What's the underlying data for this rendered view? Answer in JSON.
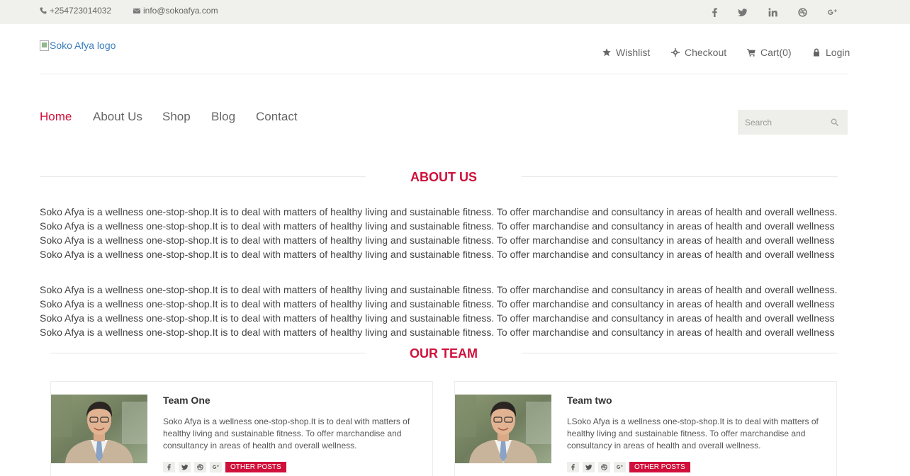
{
  "topbar": {
    "phone": "+254723014032",
    "email": "info@sokoafya.com",
    "social_icons": [
      "facebook-icon",
      "twitter-icon",
      "linkedin-icon",
      "dribbble-icon",
      "google-plus-icon"
    ]
  },
  "header": {
    "logo_alt": "Soko Afya logo",
    "wishlist": "Wishlist",
    "checkout": "Checkout",
    "cart": "Cart(0)",
    "login": "Login"
  },
  "nav": {
    "items": [
      "Home",
      "About Us",
      "Shop",
      "Blog",
      "Contact"
    ],
    "active": "Home"
  },
  "search": {
    "placeholder": "Search"
  },
  "about": {
    "title": "ABOUT US",
    "paragraph1": [
      "Soko Afya is a wellness one-stop-shop.It is to deal with matters of healthy living and sustainable fitness. To offer marchandise and consultancy in areas of health and overall wellness.",
      "Soko Afya is a wellness one-stop-shop.It is to deal with matters of healthy living and sustainable fitness. To offer marchandise and consultancy in areas of health and overall wellness",
      "Soko Afya is a wellness one-stop-shop.It is to deal with matters of healthy living and sustainable fitness. To offer marchandise and consultancy in areas of health and overall wellness",
      "Soko Afya is a wellness one-stop-shop.It is to deal with matters of healthy living and sustainable fitness. To offer marchandise and consultancy in areas of health and overall wellness"
    ],
    "paragraph2": [
      "Soko Afya is a wellness one-stop-shop.It is to deal with matters of healthy living and sustainable fitness. To offer marchandise and consultancy in areas of health and overall wellness.",
      "Soko Afya is a wellness one-stop-shop.It is to deal with matters of healthy living and sustainable fitness. To offer marchandise and consultancy in areas of health and overall wellness",
      "Soko Afya is a wellness one-stop-shop.It is to deal with matters of healthy living and sustainable fitness. To offer marchandise and consultancy in areas of health and overall wellness",
      "Soko Afya is a wellness one-stop-shop.It is to deal with matters of healthy living and sustainable fitness. To offer marchandise and consultancy in areas of health and overall wellness"
    ]
  },
  "team": {
    "title": "OUR TEAM",
    "members": [
      {
        "name": "Team One",
        "description": "Soko Afya is a wellness one-stop-shop.It is to deal with matters of healthy living and sustainable fitness. To offer marchandise and consultancy in areas of health and overall wellness.",
        "other_posts": "OTHER POSTS"
      },
      {
        "name": "Team two",
        "description": "LSoko Afya is a wellness one-stop-shop.It is to deal with matters of healthy living and sustainable fitness. To offer marchandise and consultancy in areas of health and overall wellness.",
        "other_posts": "OTHER POSTS"
      }
    ]
  },
  "colors": {
    "accent": "#d0103a",
    "topbar_bg": "#f0f0ec",
    "link": "#3a7ebf"
  }
}
